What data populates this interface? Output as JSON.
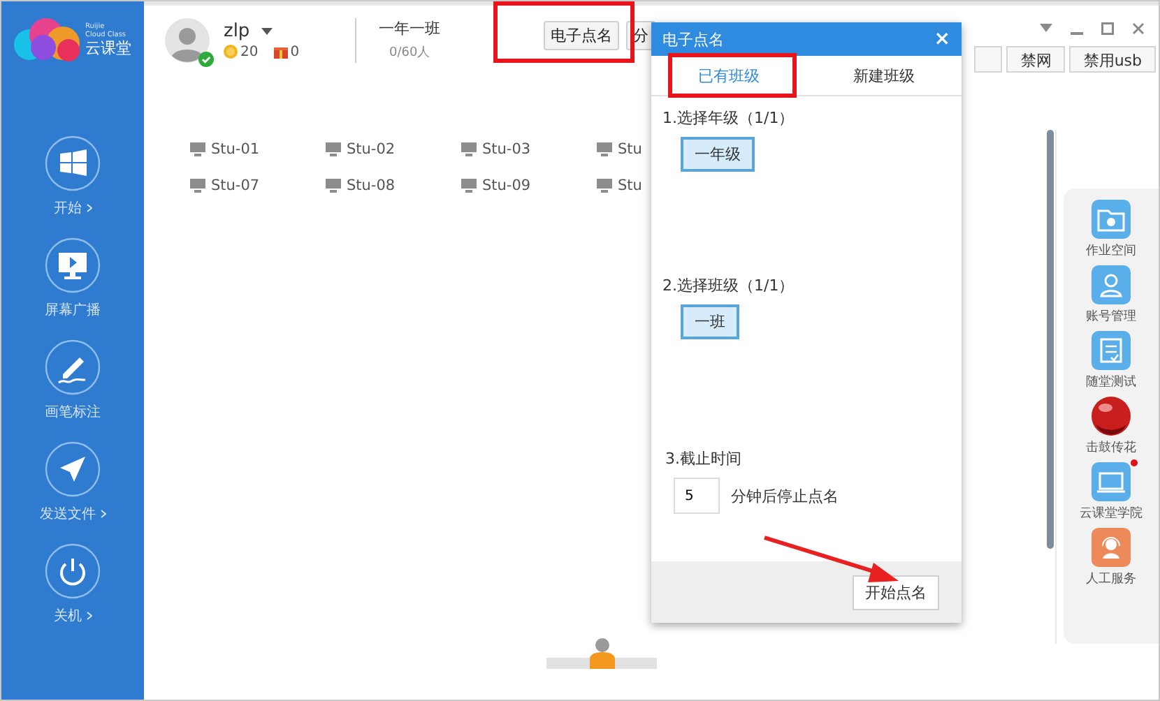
{
  "logo": {
    "text": "云课堂",
    "subtext": [
      "Ruijie",
      "Cloud Class"
    ]
  },
  "user": {
    "name": "zlp",
    "coins": "20",
    "gifts": "0"
  },
  "class_info": {
    "name": "一年一班",
    "count": "0/60人"
  },
  "toolbar_buttons": [
    "电子点名",
    "分"
  ],
  "right_buttons": [
    "禁网",
    "禁用usb"
  ],
  "sidebar": {
    "items": [
      {
        "label": "开始",
        "kind": "windows",
        "has_submenu": true
      },
      {
        "label": "屏幕广播",
        "kind": "broadcast",
        "has_submenu": false
      },
      {
        "label": "画笔标注",
        "kind": "pen",
        "has_submenu": false
      },
      {
        "label": "发送文件",
        "kind": "send",
        "has_submenu": true
      },
      {
        "label": "关机",
        "kind": "power",
        "has_submenu": true
      }
    ]
  },
  "students": [
    "Stu-01",
    "Stu-02",
    "Stu-03",
    "Stu",
    "Stu-07",
    "Stu-08",
    "Stu-09",
    "Stu"
  ],
  "right_panel": {
    "items": [
      {
        "label": "作业空间",
        "kind": "folder",
        "color": "#5aaeea",
        "new_badge": false
      },
      {
        "label": "账号管理",
        "kind": "account",
        "color": "#5aaeea",
        "new_badge": false
      },
      {
        "label": "随堂测试",
        "kind": "quiz",
        "color": "#5aaeea",
        "new_badge": false
      },
      {
        "label": "击鼓传花",
        "kind": "ball",
        "color": "#c81e1e",
        "new_badge": false
      },
      {
        "label": "云课堂学院",
        "kind": "screen",
        "color": "#5aaeea",
        "new_badge": true
      },
      {
        "label": "人工服务",
        "kind": "service",
        "color": "#ee8a5a",
        "new_badge": false
      }
    ]
  },
  "dialog": {
    "title": "电子点名",
    "close": "×",
    "tabs": [
      {
        "label": "已有班级",
        "selected": true
      },
      {
        "label": "新建班级",
        "selected": false
      }
    ],
    "grade_step": {
      "label": "1.选择年级（1/1）",
      "options": [
        {
          "label": "一年级",
          "selected": true
        }
      ]
    },
    "class_step": {
      "label": "2.选择班级（1/1）",
      "options": [
        {
          "label": "一班",
          "selected": true
        }
      ]
    },
    "deadline": {
      "label": "3.截止时间",
      "value": "5",
      "suffix": "分钟后停止点名"
    },
    "button": "开始点名"
  }
}
